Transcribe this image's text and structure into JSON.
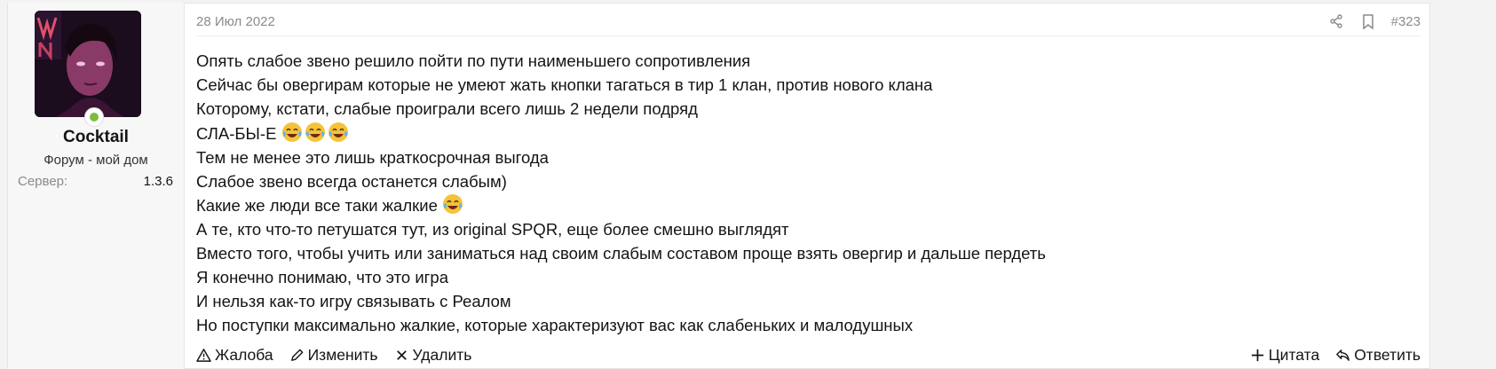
{
  "user": {
    "name": "Cocktail",
    "title": "Форум - мой дом",
    "server_label": "Сервер:",
    "server_value": "1.3.6",
    "online_color": "#7cbc3e"
  },
  "post": {
    "date": "28 Июл 2022",
    "number": "#323",
    "header_icons": [
      "share-icon",
      "bookmark-icon"
    ],
    "lines": [
      "Опять слабое звено решило пойти по пути наименьшего сопротивления",
      "Сейчас бы овергирам которые не умеют жать кнопки тагаться в тир 1 клан, против нового клана",
      "Которому, кстати, слабые проиграли всего лишь 2 недели подряд",
      "СЛА-БЫ-Е",
      "Тем не менее это лишь краткосрочная выгода",
      "Слабое звено всегда останется слабым)",
      "Какие же люди все таки жалкие",
      "А те, кто что-то петушатся тут, из original SPQR, еще более смешно выглядят",
      "Вместо того, чтобы учить или заниматься над своим слабым составом проще взять овергир и дальше пердеть",
      "Я конечно понимаю, что это игра",
      "И нельзя как-то игру связывать с Реалом",
      "Но поступки максимально жалкие, которые характеризуют вас как слабеньких и малодушных"
    ]
  },
  "footer": {
    "report": "Жалоба",
    "edit": "Изменить",
    "delete": "Удалить",
    "quote": "Цитата",
    "reply": "Ответить"
  }
}
